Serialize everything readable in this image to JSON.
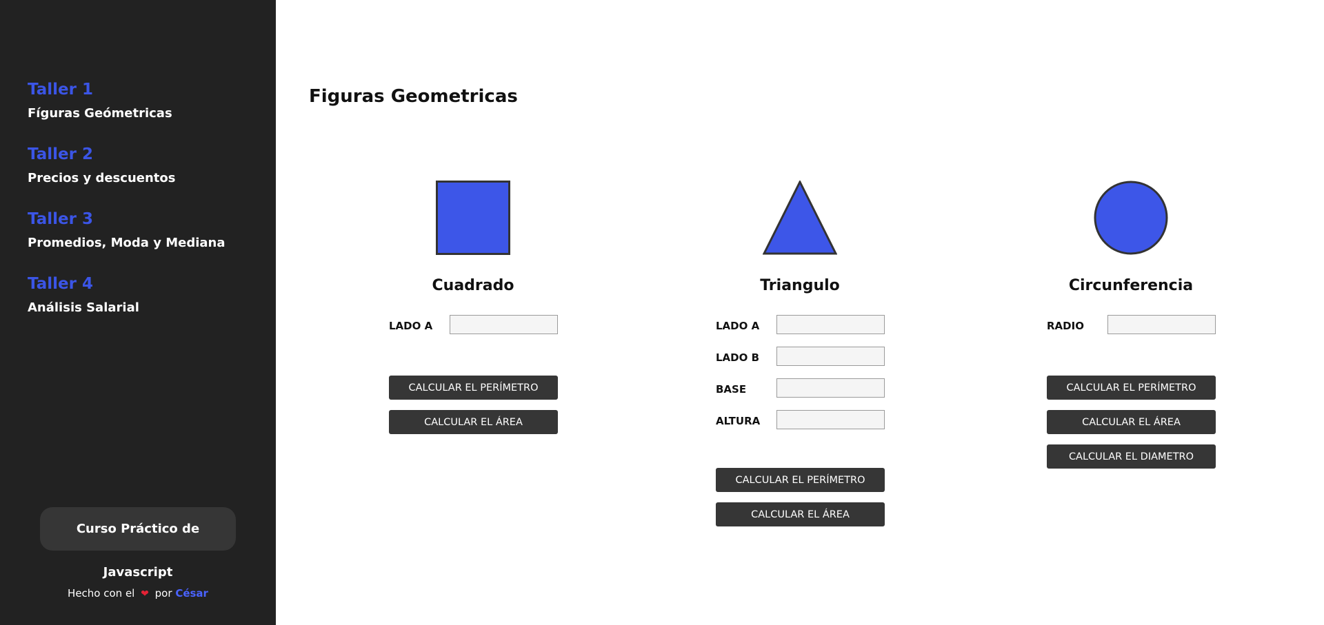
{
  "sidebar": {
    "items": [
      {
        "taller": "Taller 1",
        "label": "Fíguras Geómetricas"
      },
      {
        "taller": "Taller 2",
        "label": "Precios y descuentos"
      },
      {
        "taller": "Taller 3",
        "label": "Promedios, Moda y Mediana"
      },
      {
        "taller": "Taller 4",
        "label": "Análisis Salarial"
      }
    ],
    "course_button": "Curso Práctico de Javascript",
    "footer": {
      "prefix": "Hecho con el",
      "middle": "por",
      "author": "César"
    }
  },
  "main": {
    "title": "Figuras Geometricas",
    "cards": {
      "cuadrado": {
        "name": "Cuadrado",
        "fields": [
          "LADO A"
        ],
        "buttons": [
          "CALCULAR EL PERÍMETRO",
          "CALCULAR EL ÁREA"
        ]
      },
      "triangulo": {
        "name": "Triangulo",
        "fields": [
          "LADO A",
          "LADO B",
          "BASE",
          "ALTURA"
        ],
        "buttons": [
          "CALCULAR EL PERÍMETRO",
          "CALCULAR EL ÁREA"
        ]
      },
      "circulo": {
        "name": "Circunferencia",
        "fields": [
          "RADIO"
        ],
        "buttons": [
          "CALCULAR EL PERÍMETRO",
          "CALCULAR EL ÁREA",
          "CALCULAR EL DIAMETRO"
        ]
      }
    }
  },
  "colors": {
    "accent": "#3b55e6",
    "sidebar_bg": "#222222",
    "button_bg": "#363636",
    "shape_fill": "#3d56e8",
    "heart": "#e52235"
  },
  "icons": {
    "heart": "heart-icon"
  }
}
